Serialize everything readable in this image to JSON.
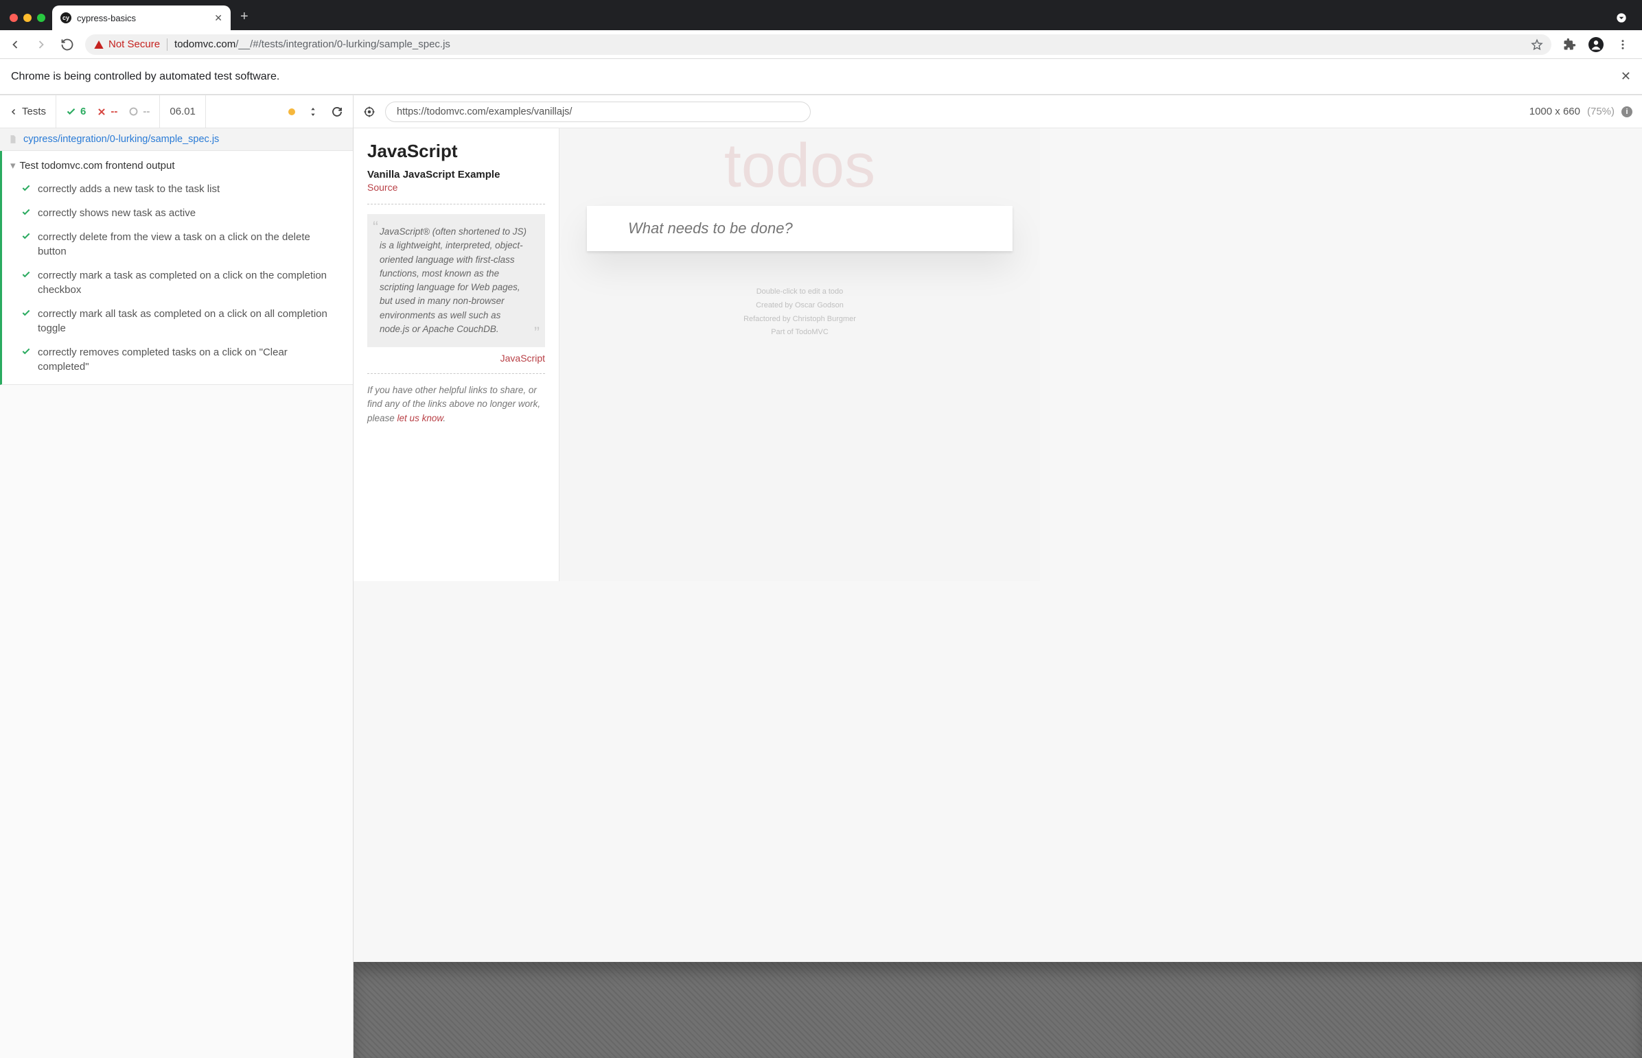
{
  "browser": {
    "tab_title": "cypress-basics",
    "not_secure_label": "Not Secure",
    "url_host": "todomvc.com",
    "url_path": "/__/#/tests/integration/0-lurking/sample_spec.js"
  },
  "infobar": {
    "message": "Chrome is being controlled by automated test software."
  },
  "cypress": {
    "tests_label": "Tests",
    "passed": "6",
    "failed": "--",
    "pending": "--",
    "elapsed": "06.01",
    "spec_path": "cypress/integration/0-lurking/sample_spec.js",
    "suite_title": "Test todomvc.com frontend output",
    "tests": [
      "correctly adds a new task to the task list",
      "correctly shows new task as active",
      "correctly delete from the view a task on a click on the delete button",
      "correctly mark a task as completed on a click on the completion checkbox",
      "correctly mark all task as completed on a click on all completion toggle",
      "correctly removes completed tasks on a click on \"Clear completed\""
    ],
    "selector_playground": "",
    "aut_url": "https://todomvc.com/examples/vanillajs/",
    "viewport_size": "1000 x 660",
    "viewport_scale": "(75%)"
  },
  "todomvc": {
    "aside_title": "JavaScript",
    "aside_subtitle": "Vanilla JavaScript Example",
    "source_label": "Source",
    "quote": "JavaScript® (often shortened to JS) is a lightweight, interpreted, object-oriented language with first-class functions, most known as the scripting language for Web pages, but used in many non-browser environments as well such as node.js or Apache CouchDB.",
    "quote_link": "JavaScript",
    "footnote_pre": "If you have other helpful links to share, or find any of the links above no longer work, please ",
    "footnote_link": "let us know",
    "app_title": "todos",
    "new_todo_placeholder": "What needs to be done?",
    "footer_line1": "Double-click to edit a todo",
    "footer_created_by": "Created by ",
    "footer_author": "Oscar Godson",
    "footer_refactored_by": "Refactored by ",
    "footer_refactorer": "Christoph Burgmer",
    "footer_part_of": "Part of ",
    "footer_project": "TodoMVC"
  }
}
